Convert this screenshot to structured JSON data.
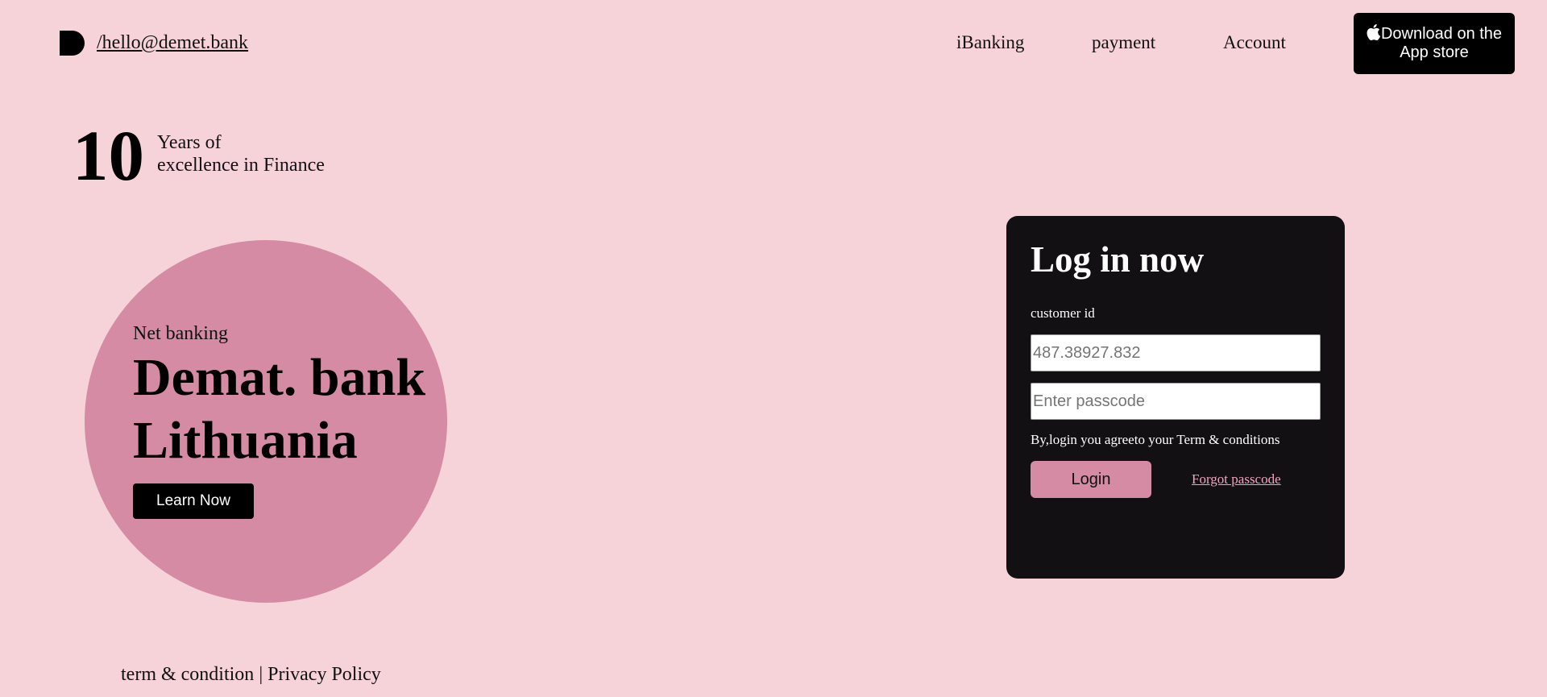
{
  "header": {
    "email": "/hello@demet.bank",
    "nav": [
      {
        "label": "iBanking"
      },
      {
        "label": "payment"
      },
      {
        "label": "Account"
      }
    ],
    "app_store": {
      "line1": "Download on the",
      "line2": "App store",
      "icon": "apple-icon"
    }
  },
  "stats": {
    "years": "10",
    "line1": "Years of",
    "line2": "excellence in Finance"
  },
  "hero": {
    "eyebrow": "Net banking",
    "title_line1": "Demat. bank",
    "title_line2": "Lithuania",
    "cta_label": "Learn Now"
  },
  "login": {
    "title": "Log in now",
    "customer_id_label": "customer id",
    "customer_id_placeholder": "487.38927.832",
    "passcode_placeholder": "Enter passcode",
    "terms_text": "By,login you agreeto your Term & conditions",
    "login_label": "Login",
    "forgot_label": "Forgot passcode"
  },
  "footer": {
    "terms": "term & condition",
    "separator": " | ",
    "privacy": "Privacy Policy"
  },
  "colors": {
    "page_background": "#f6d2d9",
    "accent_pink": "#d48ba3",
    "card_background": "#121012",
    "link_pink": "#f4a4c0"
  }
}
